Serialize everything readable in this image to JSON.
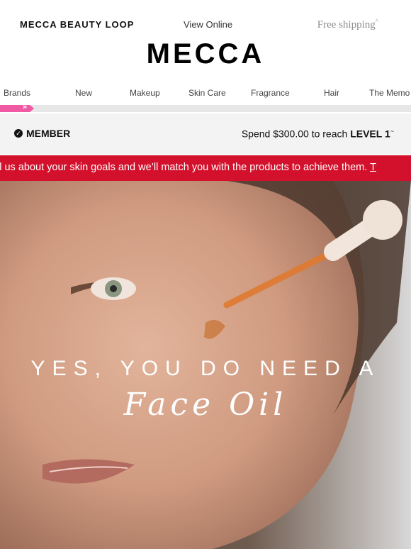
{
  "header": {
    "loop_label": "MECCA BEAUTY LOOP",
    "view_online": "View Online",
    "free_shipping": "Free shipping",
    "free_shipping_mark": "^",
    "logo": "MECCA"
  },
  "nav": {
    "items": [
      "Brands",
      "New",
      "Makeup",
      "Skin Care",
      "Fragrance",
      "Hair",
      "The Memo"
    ]
  },
  "progress": {
    "chevrons": "»",
    "fraction": 0.08,
    "fill_color": "#f05aa5"
  },
  "member": {
    "label": "MEMBER",
    "spend_prefix": "Spend $300.00 to reach",
    "level": "LEVEL 1",
    "level_mark": "~"
  },
  "banner": {
    "text": "ll us about your skin goals and we’ll match you with the products to achieve them.",
    "link_fragment": "T",
    "color": "#d3112c"
  },
  "hero": {
    "title": "YES, YOU DO NEED A",
    "script": "Face Oil"
  }
}
